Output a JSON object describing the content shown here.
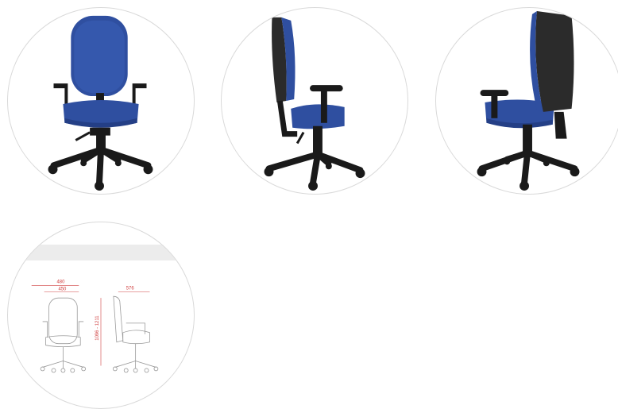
{
  "gallery": {
    "thumbnails": [
      {
        "view": "front",
        "icon": "chair-front-icon"
      },
      {
        "view": "side",
        "icon": "chair-side-icon"
      },
      {
        "view": "back-three-quarter",
        "icon": "chair-back-icon"
      },
      {
        "view": "technical-drawing",
        "icon": "chair-dimensions-icon"
      }
    ],
    "colors": {
      "upholstery": "#2f4fa0",
      "upholstery_dark": "#243f86",
      "frame": "#1a1a1a",
      "back_shell": "#2b2b2b",
      "circle_border": "#d9d9d9",
      "dimension_red": "#d04040"
    }
  },
  "drawing": {
    "width_top": "480",
    "width_seat": "450",
    "depth": "576",
    "height": "1096 - 1211"
  }
}
